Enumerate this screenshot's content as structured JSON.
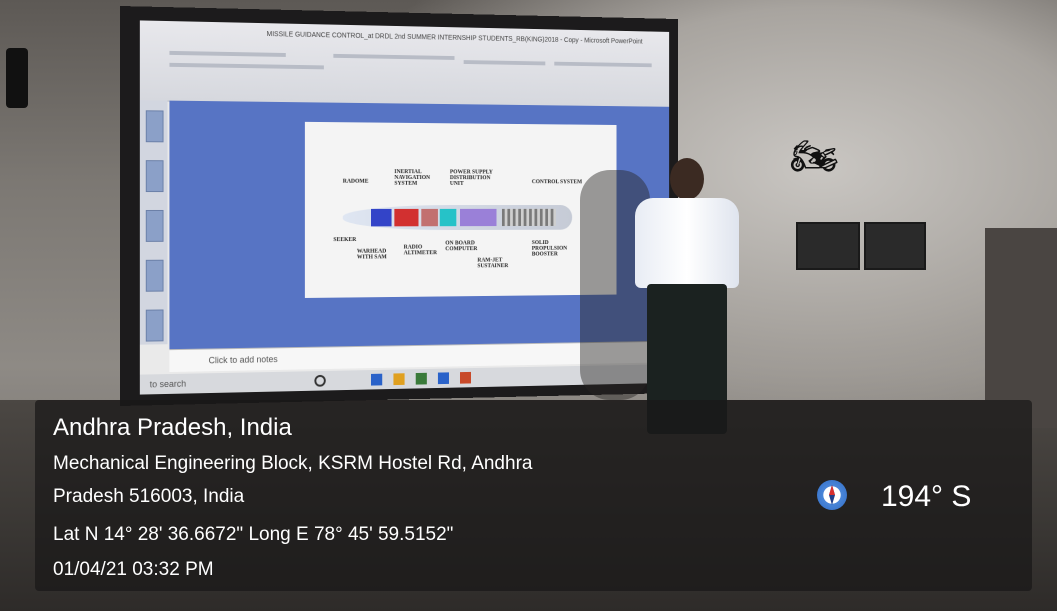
{
  "overlay": {
    "location_title": "Andhra Pradesh, India",
    "address_line1": "Mechanical Engineering Block, KSRM Hostel Rd, Andhra",
    "address_line2": "Pradesh 516003, India",
    "coordinates": "Lat N 14° 28' 36.6672\" Long E 78° 45' 59.5152\"",
    "datetime": "01/04/21 03:32 PM",
    "heading": "194° S",
    "compass_icon": "compass-icon"
  },
  "projection": {
    "window_title": "MISSILE GUIDANCE CONTROL_at DRDL 2nd SUMMER INTERNSHIP STUDENTS_RB(KING)2018 - Copy - Microsoft PowerPoint",
    "notes_placeholder": "Click to add notes",
    "taskbar_search": "to search",
    "diagram_labels": {
      "radome": "RADOME",
      "inertial": "INERTIAL NAVIGATION SYSTEM",
      "power": "POWER SUPPLY DISTRIBUTION UNIT",
      "control": "CONTROL SYSTEM",
      "seeker": "SEEKER",
      "warhead": "WARHEAD WITH SAM",
      "radio": "RADIO ALTIMETER",
      "onboard": "ON BOARD COMPUTER",
      "ramjet": "RAM-JET SUSTAINER",
      "solid": "SOLID PROPULSION BOOSTER"
    }
  },
  "colors": {
    "overlay_bg": "#191818",
    "compass_blue": "#2f6bc4",
    "slide_blue": "#5774c4"
  }
}
